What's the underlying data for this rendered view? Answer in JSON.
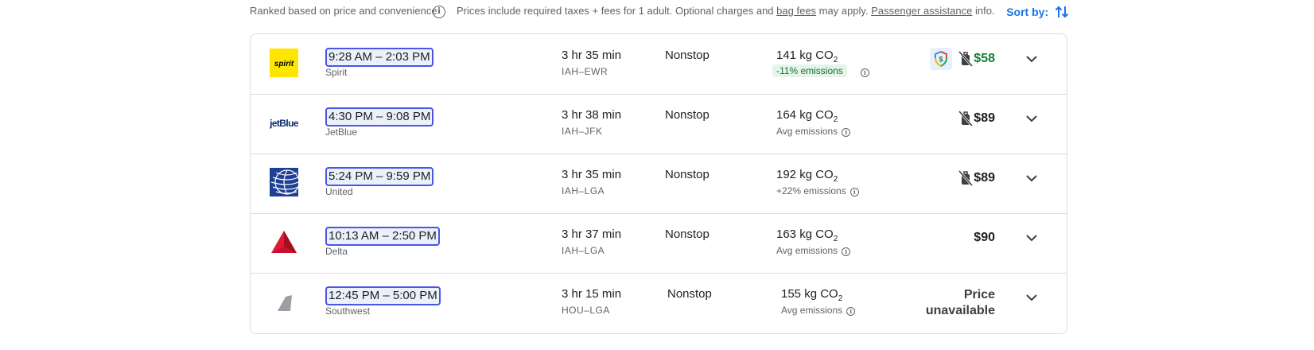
{
  "header": {
    "ranked_text": "Ranked based on price and convenience",
    "info_icon": "info-icon",
    "prices_text_1": "Prices include required taxes + fees for 1 adult. Optional charges and",
    "bag_fees_link": "bag fees",
    "prices_text_2": "may apply.",
    "passenger_link": "Passenger assistance",
    "prices_text_3": "info.",
    "sort_label": "Sort by:",
    "sort_icon": "sort-arrows-icon"
  },
  "colors": {
    "accent": "#1a73e8",
    "highlight_border": "#4b55e6",
    "green_price": "#188038",
    "emissions_badge_bg": "#e6f4ea"
  },
  "flights": [
    {
      "airline": "Spirit",
      "logo": "spirit-logo",
      "logo_text": "spirit",
      "times": "9:28 AM – 2:03 PM",
      "duration": "3 hr 35 min",
      "route": "IAH–EWR",
      "stops": "Nonstop",
      "co2_value": "141 kg CO",
      "co2_sub": "2",
      "emissions": "-11% emissions",
      "price": "$58"
    },
    {
      "airline": "JetBlue",
      "logo": "jetblue-logo",
      "logo_text": "jetBlue",
      "times": "4:30 PM – 9:08 PM",
      "duration": "3 hr 38 min",
      "route": "IAH–JFK",
      "stops": "Nonstop",
      "co2_value": "164 kg CO",
      "co2_sub": "2",
      "emissions": "Avg emissions",
      "price": "$89"
    },
    {
      "airline": "United",
      "logo": "united-globe-logo",
      "times": "5:24 PM – 9:59 PM",
      "duration": "3 hr 35 min",
      "route": "IAH–LGA",
      "stops": "Nonstop",
      "co2_value": "192 kg CO",
      "co2_sub": "2",
      "emissions": "+22% emissions",
      "price": "$89"
    },
    {
      "airline": "Delta",
      "logo": "delta-triangle-logo",
      "times": "10:13 AM – 2:50 PM",
      "duration": "3 hr 37 min",
      "route": "IAH–LGA",
      "stops": "Nonstop",
      "co2_value": "163 kg CO",
      "co2_sub": "2",
      "emissions": "Avg emissions",
      "price": "$90"
    },
    {
      "airline": "Southwest",
      "logo": "generic-tail-logo",
      "times": "12:45 PM – 5:00 PM",
      "duration": "3 hr 15 min",
      "route": "HOU–LGA",
      "stops": "Nonstop",
      "co2_value": "155 kg CO",
      "co2_sub": "2",
      "emissions": "Avg emissions",
      "price_line1": "Price",
      "price_line2": "unavailable"
    }
  ]
}
